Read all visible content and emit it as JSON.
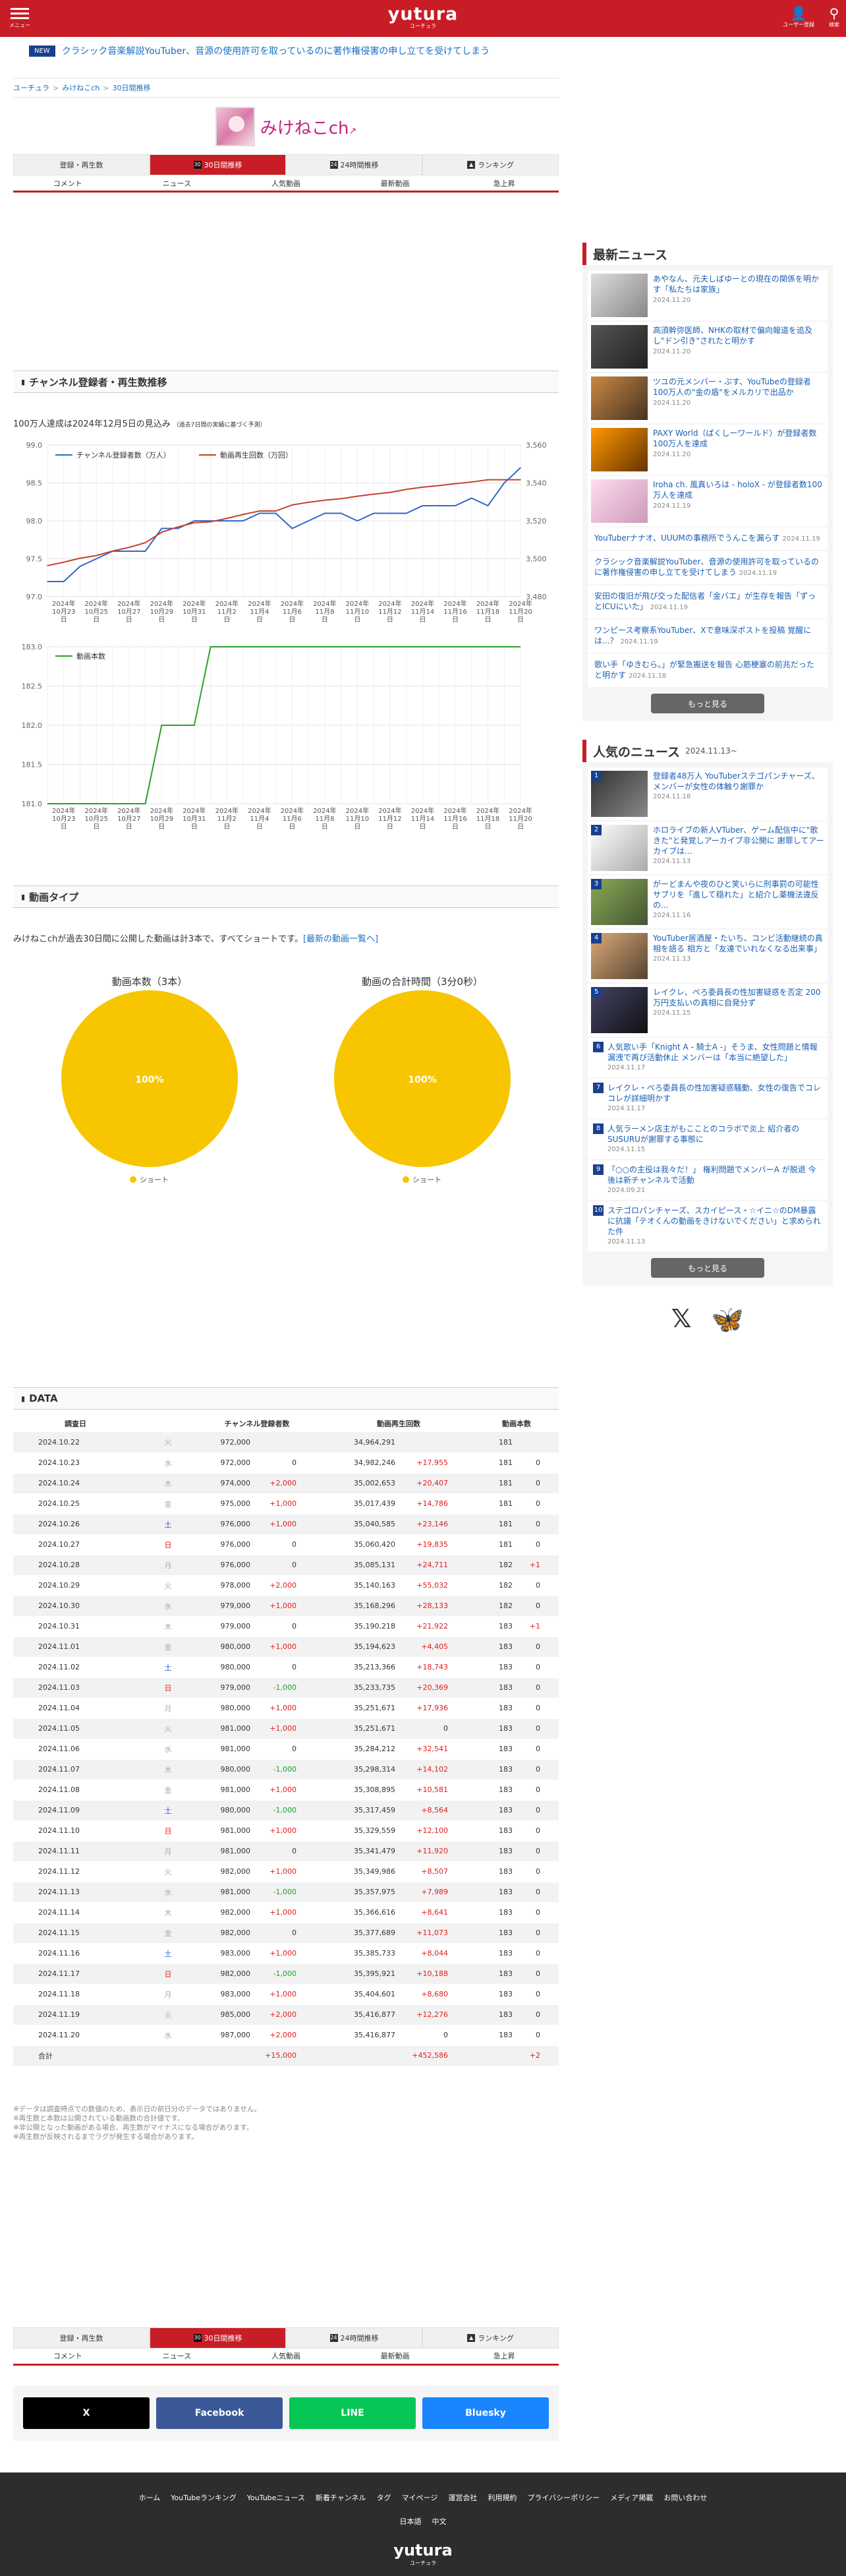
{
  "header": {
    "logo": "yutura",
    "logo_sub": "ユーチュラ",
    "user_label": "ユーザー登録",
    "search_label": "検索",
    "menu_label": "メニュー"
  },
  "ticker": {
    "badge": "NEW",
    "text": "クラシック音楽解説YouTuber、音源の使用許可を取っているのに著作権侵害の申し立てを受けてしまう"
  },
  "breadcrumb": [
    "ユーチュラ",
    "みけねこch",
    "30日間推移"
  ],
  "channel": {
    "name": "みけねこch"
  },
  "tabs_main": [
    "登録・再生数",
    "30日間推移",
    "24時間推移",
    "ランキング"
  ],
  "tabs_sub": [
    "コメント",
    "ニュース",
    "人気動画",
    "最新動画",
    "急上昇"
  ],
  "section1": {
    "title": "チャンネル登録者・再生数推移",
    "forecast": "100万人達成は2024年12月5日の見込み",
    "forecast_note": "（過去7日間の実績に基づく予測）"
  },
  "chart_data": [
    {
      "type": "line",
      "series": [
        {
          "name": "チャンネル登録者数（万人）",
          "color": "#3366cc",
          "axis": "left",
          "values": [
            97.2,
            97.2,
            97.4,
            97.5,
            97.6,
            97.6,
            97.6,
            97.9,
            97.9,
            98.0,
            98.0,
            98.0,
            98.0,
            98.1,
            98.1,
            97.9,
            98.0,
            98.1,
            98.1,
            98.0,
            98.1,
            98.1,
            98.1,
            98.2,
            98.2,
            98.2,
            98.3,
            98.2,
            98.5,
            98.7
          ]
        },
        {
          "name": "動画再生回数（万回）",
          "color": "#c8402a",
          "axis": "right",
          "values": [
            3496.4,
            3498.2,
            3500.3,
            3501.7,
            3504.1,
            3506.0,
            3508.5,
            3514.0,
            3516.8,
            3519.0,
            3519.5,
            3521.3,
            3523.4,
            3525.2,
            3525.2,
            3528.4,
            3529.8,
            3530.9,
            3531.7,
            3533.0,
            3534.1,
            3535.0,
            3536.6,
            3537.8,
            3538.6,
            3539.6,
            3540.5,
            3541.7,
            3541.7,
            3541.7
          ]
        }
      ],
      "x": [
        "2024.10.22",
        "2024.10.23",
        "2024.10.24",
        "2024.10.25",
        "2024.10.26",
        "2024.10.27",
        "2024.10.28",
        "2024.10.29",
        "2024.10.30",
        "2024.10.31",
        "2024.11.01",
        "2024.11.02",
        "2024.11.03",
        "2024.11.04",
        "2024.11.05",
        "2024.11.06",
        "2024.11.07",
        "2024.11.08",
        "2024.11.09",
        "2024.11.10",
        "2024.11.11",
        "2024.11.12",
        "2024.11.13",
        "2024.11.14",
        "2024.11.15",
        "2024.11.16",
        "2024.11.17",
        "2024.11.18",
        "2024.11.19",
        "2024.11.20"
      ],
      "xticks": [
        "2024年10月23日",
        "2024年10月25日",
        "2024年10月27日",
        "2024年10月29日",
        "2024年10月31日",
        "2024年11月2日",
        "2024年11月4日",
        "2024年11月6日",
        "2024年11月8日",
        "2024年11月10日",
        "2024年11月12日",
        "2024年11月14日",
        "2024年11月16日",
        "2024年11月18日",
        "2024年11月20日"
      ],
      "ylim_left": [
        97.0,
        99.0
      ],
      "yticks_left": [
        "99.0",
        "98.5",
        "98.0",
        "97.5",
        "97.0"
      ],
      "ylim_right": [
        3480,
        3560
      ],
      "yticks_right": [
        "3,560",
        "3,540",
        "3,520",
        "3,500",
        "3,480"
      ],
      "grid": true,
      "legend": "top-left"
    },
    {
      "type": "line",
      "series": [
        {
          "name": "動画本数",
          "color": "#2ca02c",
          "values": [
            181,
            181,
            181,
            181,
            181,
            181,
            181,
            182,
            182,
            182,
            183,
            183,
            183,
            183,
            183,
            183,
            183,
            183,
            183,
            183,
            183,
            183,
            183,
            183,
            183,
            183,
            183,
            183,
            183,
            183
          ]
        }
      ],
      "xticks": [
        "2024年10月23日",
        "2024年10月25日",
        "2024年10月27日",
        "2024年10月29日",
        "2024年10月31日",
        "2024年11月2日",
        "2024年11月4日",
        "2024年11月6日",
        "2024年11月8日",
        "2024年11月10日",
        "2024年11月12日",
        "2024年11月14日",
        "2024年11月16日",
        "2024年11月18日",
        "2024年11月20日"
      ],
      "ylim": [
        181.0,
        183.0
      ],
      "yticks": [
        "183.0",
        "182.5",
        "182.0",
        "181.5",
        "181.0"
      ],
      "grid": true,
      "legend": "top-left"
    },
    {
      "type": "pie",
      "title": "動画本数（3本）",
      "slices": [
        {
          "label": "ショート",
          "value": 100,
          "color": "#f7c600"
        }
      ],
      "center_label": "100%"
    },
    {
      "type": "pie",
      "title": "動画の合計時間（3分0秒）",
      "slices": [
        {
          "label": "ショート",
          "value": 100,
          "color": "#f7c600"
        }
      ],
      "center_label": "100%"
    }
  ],
  "section2": {
    "title": "動画タイプ",
    "text": "みけねこchが過去30日間に公開した動画は計3本で、すべてショートです。",
    "link": "[最新の動画一覧へ]"
  },
  "data_section": {
    "title": "DATA",
    "headers": [
      "調査日",
      "チャンネル登録者数",
      "動画再生回数",
      "動画本数"
    ],
    "rows": [
      [
        "2024.10.22",
        "火",
        "972,000",
        "",
        "34,964,291",
        "",
        "181",
        ""
      ],
      [
        "2024.10.23",
        "水",
        "972,000",
        "0",
        "34,982,246",
        "+17,955",
        "181",
        "0"
      ],
      [
        "2024.10.24",
        "木",
        "974,000",
        "+2,000",
        "35,002,653",
        "+20,407",
        "181",
        "0"
      ],
      [
        "2024.10.25",
        "金",
        "975,000",
        "+1,000",
        "35,017,439",
        "+14,786",
        "181",
        "0"
      ],
      [
        "2024.10.26",
        "土",
        "976,000",
        "+1,000",
        "35,040,585",
        "+23,146",
        "181",
        "0"
      ],
      [
        "2024.10.27",
        "日",
        "976,000",
        "0",
        "35,060,420",
        "+19,835",
        "181",
        "0"
      ],
      [
        "2024.10.28",
        "月",
        "976,000",
        "0",
        "35,085,131",
        "+24,711",
        "182",
        "+1"
      ],
      [
        "2024.10.29",
        "火",
        "978,000",
        "+2,000",
        "35,140,163",
        "+55,032",
        "182",
        "0"
      ],
      [
        "2024.10.30",
        "水",
        "979,000",
        "+1,000",
        "35,168,296",
        "+28,133",
        "182",
        "0"
      ],
      [
        "2024.10.31",
        "木",
        "979,000",
        "0",
        "35,190,218",
        "+21,922",
        "183",
        "+1"
      ],
      [
        "2024.11.01",
        "金",
        "980,000",
        "+1,000",
        "35,194,623",
        "+4,405",
        "183",
        "0"
      ],
      [
        "2024.11.02",
        "土",
        "980,000",
        "0",
        "35,213,366",
        "+18,743",
        "183",
        "0"
      ],
      [
        "2024.11.03",
        "日",
        "979,000",
        "-1,000",
        "35,233,735",
        "+20,369",
        "183",
        "0"
      ],
      [
        "2024.11.04",
        "月",
        "980,000",
        "+1,000",
        "35,251,671",
        "+17,936",
        "183",
        "0"
      ],
      [
        "2024.11.05",
        "火",
        "981,000",
        "+1,000",
        "35,251,671",
        "0",
        "183",
        "0"
      ],
      [
        "2024.11.06",
        "水",
        "981,000",
        "0",
        "35,284,212",
        "+32,541",
        "183",
        "0"
      ],
      [
        "2024.11.07",
        "木",
        "980,000",
        "-1,000",
        "35,298,314",
        "+14,102",
        "183",
        "0"
      ],
      [
        "2024.11.08",
        "金",
        "981,000",
        "+1,000",
        "35,308,895",
        "+10,581",
        "183",
        "0"
      ],
      [
        "2024.11.09",
        "土",
        "980,000",
        "-1,000",
        "35,317,459",
        "+8,564",
        "183",
        "0"
      ],
      [
        "2024.11.10",
        "日",
        "981,000",
        "+1,000",
        "35,329,559",
        "+12,100",
        "183",
        "0"
      ],
      [
        "2024.11.11",
        "月",
        "981,000",
        "0",
        "35,341,479",
        "+11,920",
        "183",
        "0"
      ],
      [
        "2024.11.12",
        "火",
        "982,000",
        "+1,000",
        "35,349,986",
        "+8,507",
        "183",
        "0"
      ],
      [
        "2024.11.13",
        "水",
        "981,000",
        "-1,000",
        "35,357,975",
        "+7,989",
        "183",
        "0"
      ],
      [
        "2024.11.14",
        "木",
        "982,000",
        "+1,000",
        "35,366,616",
        "+8,641",
        "183",
        "0"
      ],
      [
        "2024.11.15",
        "金",
        "982,000",
        "0",
        "35,377,689",
        "+11,073",
        "183",
        "0"
      ],
      [
        "2024.11.16",
        "土",
        "983,000",
        "+1,000",
        "35,385,733",
        "+8,044",
        "183",
        "0"
      ],
      [
        "2024.11.17",
        "日",
        "982,000",
        "-1,000",
        "35,395,921",
        "+10,188",
        "183",
        "0"
      ],
      [
        "2024.11.18",
        "月",
        "983,000",
        "+1,000",
        "35,404,601",
        "+8,680",
        "183",
        "0"
      ],
      [
        "2024.11.19",
        "火",
        "985,000",
        "+2,000",
        "35,416,877",
        "+12,276",
        "183",
        "0"
      ],
      [
        "2024.11.20",
        "水",
        "987,000",
        "+2,000",
        "35,416,877",
        "0",
        "183",
        "0"
      ]
    ],
    "total": [
      "合計",
      "+15,000",
      "+452,586",
      "+2"
    ]
  },
  "notes": [
    "※データは調査時点での数値のため、表示日の前日分のデータではありません。",
    "※再生数と本数は公開されている動画数の合計値です。",
    "※非公開となった動画がある場合、再生数がマイナスになる場合があります。",
    "※再生数が反映されるまでラグが発生する場合があります。"
  ],
  "share": [
    "X",
    "Facebook",
    "LINE",
    "Bluesky"
  ],
  "footer": {
    "links": [
      "ホーム",
      "YouTubeランキング",
      "YouTubeニュース",
      "新着チャンネル",
      "タグ",
      "マイページ",
      "運営会社",
      "利用規約",
      "プライバシーポリシー",
      "メディア掲載",
      "お問い合わせ"
    ],
    "langs": [
      "日本語",
      "中文"
    ],
    "logo": "yutura",
    "logo_sub": "ユーチュラ"
  },
  "sidebar": {
    "latest_title": "最新ニュース",
    "popular_title": "人気のニュース",
    "popular_range": "2024.11.13~",
    "more": "もっと見る",
    "latest": [
      {
        "t": "あやなん、元夫しばゆーとの現在の関係を明かす「私たちは家族」",
        "d": "2024.11.20"
      },
      {
        "t": "高須幹弥医師、NHKの取材で偏向報道を追及し\"ドン引き\"されたと明かす",
        "d": "2024.11.20"
      },
      {
        "t": "ツユの元メンバー・ぷす、YouTubeの登録者100万人の\"金の盾\"をメルカリで出品か",
        "d": "2024.11.20"
      },
      {
        "t": "PAXY World（ぱくしーワールド）が登録者数100万人を達成",
        "d": "2024.11.20"
      },
      {
        "t": "Iroha ch. 風真いろは - holoX - が登録者数100万人を達成",
        "d": "2024.11.19"
      }
    ],
    "latest_text": [
      {
        "t": "YouTuberナナオ、UUUMの事務所でうんこを漏らす",
        "d": "2024.11.19"
      },
      {
        "t": "クラシック音楽解説YouTuber、音源の使用許可を取っているのに著作権侵害の申し立てを受けてしまう",
        "d": "2024.11.19"
      },
      {
        "t": "安田の復旧が飛び交った配信者「金バエ」が生存を報告「ずっとICUにいた」",
        "d": "2024.11.19"
      },
      {
        "t": "ワンピース考察系YouTuber、Xで意味深ポストを投稿 覚醒には...？",
        "d": "2024.11.19"
      },
      {
        "t": "歌い手「ゆきむら。」が緊急搬送を報告 心筋梗塞の前兆だったと明かす",
        "d": "2024.11.18"
      }
    ],
    "popular": [
      {
        "r": "1",
        "t": "登録者48万人 YouTuberステゴパンチャーズ、メンバーが女性の体触り謝罪か",
        "d": "2024.11.18"
      },
      {
        "r": "2",
        "t": "ホロライブの新人VTuber、ゲーム配信中に\"歌きた\"と発覚しアーカイブ非公開に 謝罪してアーカイブは...",
        "d": "2024.11.13"
      },
      {
        "r": "3",
        "t": "がーどまんや夜のひと笑いらに刑事罰の可能性 サブリを「進して穏れた」と紹介し薬機法違反の...",
        "d": "2024.11.16"
      },
      {
        "r": "4",
        "t": "YouTuber居酒屋・たいち、コンビ活動継続の真相を語る 相方と「友達でいれなくなる出来事」",
        "d": "2024.11.13"
      },
      {
        "r": "5",
        "t": "レイクレ、ぺろ委員長の性加害疑惑を否定 200万円支払いの真相に自発分ず",
        "d": "2024.11.15"
      }
    ],
    "popular_text": [
      {
        "r": "6",
        "t": "人気歌い手「Knight A - 騎士A -」そうま、女性問題と情報漏洩で再び活動休止 メンバーは「本当に絶望した」",
        "d": "2024.11.17"
      },
      {
        "r": "7",
        "t": "レイクレ・ぺろ委員長の性加害疑惑騒動、女性の復告でコレコレが詳細明かす",
        "d": "2024.11.17"
      },
      {
        "r": "8",
        "t": "人気ラーメン店主がもこことのコラボで炎上 紹介者のSUSURUが謝罪する事態に",
        "d": "2024.11.15"
      },
      {
        "r": "9",
        "t": "「○○の主役は我々だ！」 権利問題でメンバーA が脱退 今後は新チャンネルで活動",
        "d": "2024.09.21"
      },
      {
        "r": "10",
        "t": "ステゴロパンチャーズ、スカイピース・☆イニ☆のDM暴露に抗議「テオくんの動画をきけないでください」と求められた件",
        "d": "2024.11.13"
      }
    ]
  }
}
